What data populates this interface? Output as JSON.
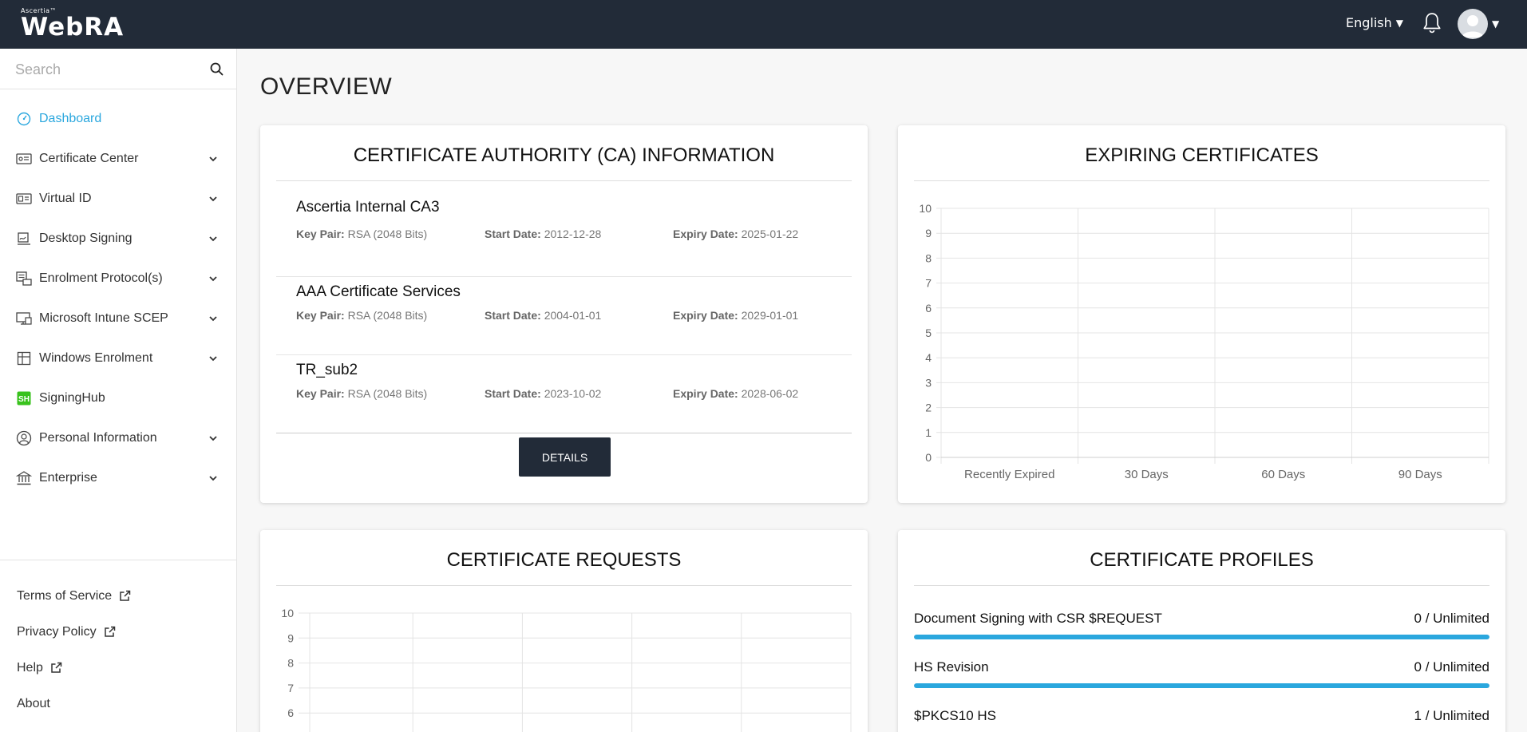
{
  "header": {
    "brand_small": "Ascertia™",
    "brand_main": "WebRA",
    "language": "English"
  },
  "sidebar": {
    "search_placeholder": "Search",
    "items": [
      {
        "label": "Dashboard",
        "icon": "dashboard-icon",
        "active": true,
        "has_chevron": false
      },
      {
        "label": "Certificate Center",
        "icon": "certificate-icon",
        "has_chevron": true
      },
      {
        "label": "Virtual ID",
        "icon": "id-card-icon",
        "has_chevron": true
      },
      {
        "label": "Desktop Signing",
        "icon": "signing-icon",
        "has_chevron": true
      },
      {
        "label": "Enrolment Protocol(s)",
        "icon": "enrolment-icon",
        "has_chevron": true
      },
      {
        "label": "Microsoft Intune SCEP",
        "icon": "monitor-icon",
        "has_chevron": true
      },
      {
        "label": "Windows Enrolment",
        "icon": "windows-icon",
        "has_chevron": true
      },
      {
        "label": "SigningHub",
        "icon": "signinghub-icon",
        "has_chevron": false
      },
      {
        "label": "Personal Information",
        "icon": "user-circle-icon",
        "has_chevron": true
      },
      {
        "label": "Enterprise",
        "icon": "bank-icon",
        "has_chevron": true
      }
    ],
    "footer": [
      {
        "label": "Terms of Service",
        "external": true
      },
      {
        "label": "Privacy Policy",
        "external": true
      },
      {
        "label": "Help",
        "external": true
      },
      {
        "label": "About",
        "external": false
      }
    ]
  },
  "main": {
    "page_title": "OVERVIEW",
    "ca_card": {
      "title": "CERTIFICATE AUTHORITY (CA) INFORMATION",
      "key_pair_label": "Key Pair:",
      "start_label": "Start Date:",
      "expiry_label": "Expiry Date:",
      "rows": [
        {
          "name": "Ascertia Internal CA3",
          "key_pair": "RSA (2048 Bits)",
          "start": "2012-12-28",
          "expiry": "2025-01-22"
        },
        {
          "name": "AAA Certificate Services",
          "key_pair": "RSA (2048 Bits)",
          "start": "2004-01-01",
          "expiry": "2029-01-01"
        },
        {
          "name": "TR_sub2",
          "key_pair": "RSA (2048 Bits)",
          "start": "2023-10-02",
          "expiry": "2028-06-02"
        }
      ],
      "details_button": "DETAILS"
    },
    "expiring_card": {
      "title": "EXPIRING CERTIFICATES"
    },
    "requests_card": {
      "title": "CERTIFICATE REQUESTS"
    },
    "profiles_card": {
      "title": "CERTIFICATE PROFILES",
      "rows": [
        {
          "name": "Document Signing with CSR $REQUEST",
          "count": "0 / Unlimited",
          "fill": 1.0
        },
        {
          "name": "HS Revision",
          "count": "0 / Unlimited",
          "fill": 1.0
        },
        {
          "name": "$PKCS10 HS",
          "count": "1 / Unlimited",
          "fill": 1.0
        }
      ]
    }
  },
  "chart_data": [
    {
      "type": "bar",
      "categories": [
        "Recently Expired",
        "30 Days",
        "60 Days",
        "90 Days"
      ],
      "values": [
        0,
        0,
        0,
        0
      ],
      "ylim": [
        0,
        10
      ],
      "yticks": [
        0,
        1,
        2,
        3,
        4,
        5,
        6,
        7,
        8,
        9,
        10
      ],
      "grid": true
    },
    {
      "type": "bar",
      "categories": [],
      "values": [],
      "ylim": [
        0,
        10
      ],
      "yticks_visible": [
        10,
        9,
        8,
        7,
        6
      ],
      "grid": true
    }
  ],
  "colors": {
    "header_bg": "#222b38",
    "accent": "#2aa7de",
    "button_bg": "#222b38"
  }
}
